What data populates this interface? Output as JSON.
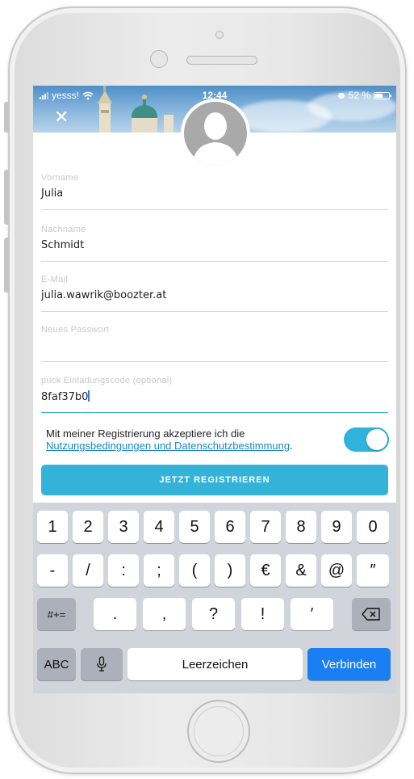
{
  "status_bar": {
    "carrier": "yesss!",
    "time": "12:44",
    "battery": "52 %"
  },
  "header": {
    "close_icon": "close-icon",
    "avatar_icon": "person-silhouette-icon"
  },
  "form": {
    "first_name": {
      "label": "Vorname",
      "value": "Julia"
    },
    "last_name": {
      "label": "Nachname",
      "value": "Schmidt"
    },
    "email": {
      "label": "E-Mail",
      "value": "julia.wawrik@boozter.at"
    },
    "password": {
      "label": "Neues Passwort",
      "value": ""
    },
    "invite_code": {
      "label": "puck Einladungscode (optional)",
      "value": "8faf37b0"
    }
  },
  "consent": {
    "text": "Mit meiner Registrierung akzeptiere ich die",
    "link": "Nutzungsbedingungen und Datenschutzbestimmung",
    "suffix": ".",
    "toggle_on": true
  },
  "register_button": "JETZT REGISTRIEREN",
  "keyboard": {
    "row1": [
      "1",
      "2",
      "3",
      "4",
      "5",
      "6",
      "7",
      "8",
      "9",
      "0"
    ],
    "row2": [
      "-",
      "/",
      ":",
      ";",
      "(",
      ")",
      "€",
      "&",
      "@",
      "″"
    ],
    "row3": {
      "mode": "#+=",
      "keys": [
        ".",
        ",",
        "?",
        "!",
        "′"
      ],
      "backspace_icon": "backspace-icon"
    },
    "row4": {
      "abc": "ABC",
      "mic_icon": "microphone-icon",
      "space": "Leerzeichen",
      "action": "Verbinden"
    }
  },
  "colors": {
    "accent": "#33b3d8",
    "link": "#1a87c4",
    "action_key": "#1a7ff2"
  }
}
